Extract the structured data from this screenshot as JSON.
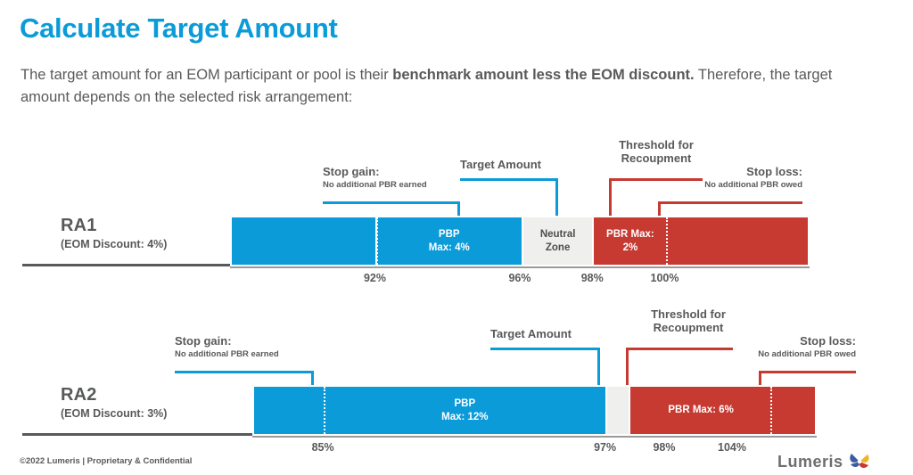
{
  "header": {
    "title": "Calculate Target Amount",
    "subtitle_part1": "The target amount for an EOM participant or pool is their ",
    "subtitle_bold": "benchmark amount less the EOM discount.",
    "subtitle_part2": " Therefore, the target amount depends on the selected risk arrangement:"
  },
  "colors": {
    "accent_blue": "#0b9bd8",
    "accent_red": "#c63a32",
    "neutral_grey": "#efefee",
    "text_grey": "#58595b"
  },
  "chart_data": {
    "type": "bar",
    "title": "Calculate Target Amount",
    "orientation": "horizontal-stacked",
    "xlabel": "",
    "ylabel": "",
    "axis_unit": "percent of benchmark",
    "rows": [
      {
        "name": "RA1",
        "discount_label": "(EOM Discount: 4%)",
        "segments": [
          {
            "label": "",
            "sub": "",
            "color": "blue",
            "start": 88.0,
            "end": 92.0
          },
          {
            "label": "PBP",
            "sub": "Max: 4%",
            "color": "blue",
            "start": 92.0,
            "end": 96.0
          },
          {
            "label": "Neutral",
            "sub": "Zone",
            "color": "grey",
            "start": 96.0,
            "end": 98.0
          },
          {
            "label": "PBR Max:",
            "sub": "2%",
            "color": "red",
            "start": 98.0,
            "end": 100.0
          },
          {
            "label": "",
            "sub": "",
            "color": "red",
            "start": 100.0,
            "end": 104.0
          }
        ],
        "ticks": [
          {
            "value": "92%",
            "pos": 92.0
          },
          {
            "value": "96%",
            "pos": 96.0
          },
          {
            "value": "98%",
            "pos": 98.0
          },
          {
            "value": "100%",
            "pos": 100.0
          }
        ],
        "callouts": [
          {
            "title": "Stop gain:",
            "sub": "No additional PBR earned",
            "color": "blue",
            "target": 92.0
          },
          {
            "title": "Target Amount",
            "sub": "",
            "color": "blue",
            "target": 96.0
          },
          {
            "title": "Threshold for",
            "sub2": "Recoupment",
            "color": "red",
            "target": 98.0
          },
          {
            "title": "Stop loss:",
            "sub": "No additional PBR owed",
            "color": "red",
            "target": 100.0
          }
        ]
      },
      {
        "name": "RA2",
        "discount_label": "(EOM Discount: 3%)",
        "segments": [
          {
            "label": "",
            "sub": "",
            "color": "blue",
            "start": 82.0,
            "end": 85.0
          },
          {
            "label": "PBP",
            "sub": "Max: 12%",
            "color": "blue",
            "start": 85.0,
            "end": 97.0
          },
          {
            "label": "",
            "sub": "",
            "color": "grey",
            "start": 97.0,
            "end": 98.0
          },
          {
            "label": "PBR Max: 6%",
            "sub": "",
            "color": "red",
            "start": 98.0,
            "end": 104.0
          },
          {
            "label": "",
            "sub": "",
            "color": "red",
            "start": 104.0,
            "end": 106.0
          }
        ],
        "ticks": [
          {
            "value": "85%",
            "pos": 85.0
          },
          {
            "value": "97%",
            "pos": 97.0
          },
          {
            "value": "98%",
            "pos": 98.0
          },
          {
            "value": "104%",
            "pos": 104.0
          }
        ],
        "callouts": [
          {
            "title": "Stop gain:",
            "sub": "No additional PBR earned",
            "color": "blue",
            "target": 85.0
          },
          {
            "title": "Target Amount",
            "sub": "",
            "color": "blue",
            "target": 97.0
          },
          {
            "title": "Threshold for",
            "sub2": "Recoupment",
            "color": "red",
            "target": 98.0
          },
          {
            "title": "Stop loss:",
            "sub": "No additional PBR owed",
            "color": "red",
            "target": 104.0
          }
        ]
      }
    ]
  },
  "ra1": {
    "name": "RA1",
    "discount": "(EOM Discount: 4%)",
    "seg_pbp_label": "PBP",
    "seg_pbp_sub": "Max: 4%",
    "seg_nz_label": "Neutral",
    "seg_nz_sub": "Zone",
    "seg_pbr_label": "PBR Max:",
    "seg_pbr_sub": "2%",
    "tick1": "92%",
    "tick2": "96%",
    "tick3": "98%",
    "tick4": "100%",
    "callout_stopgain_title": "Stop gain:",
    "callout_stopgain_sub": "No additional PBR earned",
    "callout_target_title": "Target Amount",
    "callout_threshold_l1": "Threshold for",
    "callout_threshold_l2": "Recoupment",
    "callout_stoploss_title": "Stop loss:",
    "callout_stoploss_sub": "No additional PBR owed"
  },
  "ra2": {
    "name": "RA2",
    "discount": "(EOM Discount: 3%)",
    "seg_pbp_label": "PBP",
    "seg_pbp_sub": "Max: 12%",
    "seg_pbr_label": "PBR Max: 6%",
    "tick1": "85%",
    "tick2": "97%",
    "tick3": "98%",
    "tick4": "104%",
    "callout_stopgain_title": "Stop gain:",
    "callout_stopgain_sub": "No additional PBR earned",
    "callout_target_title": "Target Amount",
    "callout_threshold_l1": "Threshold for",
    "callout_threshold_l2": "Recoupment",
    "callout_stoploss_title": "Stop loss:",
    "callout_stoploss_sub": "No additional PBR owed"
  },
  "footer": {
    "copyright": "©2022 Lumeris | Proprietary & Confidential",
    "logo_word": "Lumeris"
  }
}
